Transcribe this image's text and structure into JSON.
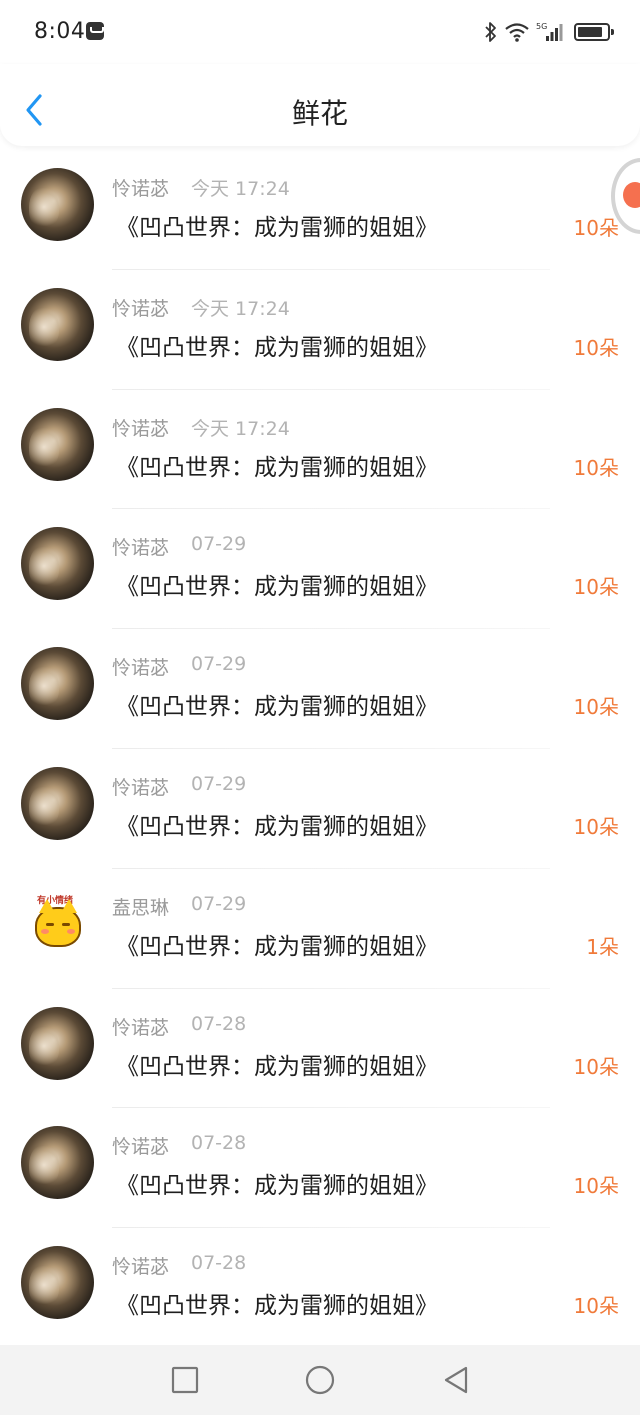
{
  "status_bar": {
    "time": "8:04",
    "icons": [
      "message-icon",
      "bluetooth-icon",
      "wifi-icon",
      "signal-5g-icon",
      "battery-icon"
    ]
  },
  "header": {
    "title": "鲜花",
    "back_icon": "chevron-left-icon",
    "accent_color": "#2196f3"
  },
  "items": [
    {
      "user": "怜诺苾",
      "time": "今天 17:24",
      "title": "《凹凸世界：成为雷狮的姐姐》",
      "count": "10朵",
      "avatar": "photo"
    },
    {
      "user": "怜诺苾",
      "time": "今天 17:24",
      "title": "《凹凸世界：成为雷狮的姐姐》",
      "count": "10朵",
      "avatar": "photo"
    },
    {
      "user": "怜诺苾",
      "time": "今天 17:24",
      "title": "《凹凸世界：成为雷狮的姐姐》",
      "count": "10朵",
      "avatar": "photo"
    },
    {
      "user": "怜诺苾",
      "time": "07-29",
      "title": "《凹凸世界：成为雷狮的姐姐》",
      "count": "10朵",
      "avatar": "photo"
    },
    {
      "user": "怜诺苾",
      "time": "07-29",
      "title": "《凹凸世界：成为雷狮的姐姐》",
      "count": "10朵",
      "avatar": "photo"
    },
    {
      "user": "怜诺苾",
      "time": "07-29",
      "title": "《凹凸世界：成为雷狮的姐姐》",
      "count": "10朵",
      "avatar": "photo"
    },
    {
      "user": "盍思琳",
      "time": "07-29",
      "title": "《凹凸世界：成为雷狮的姐姐》",
      "count": "1朵",
      "avatar": "cat",
      "avatar_text": "有小情绪"
    },
    {
      "user": "怜诺苾",
      "time": "07-28",
      "title": "《凹凸世界：成为雷狮的姐姐》",
      "count": "10朵",
      "avatar": "photo"
    },
    {
      "user": "怜诺苾",
      "time": "07-28",
      "title": "《凹凸世界：成为雷狮的姐姐》",
      "count": "10朵",
      "avatar": "photo"
    },
    {
      "user": "怜诺苾",
      "time": "07-28",
      "title": "《凹凸世界：成为雷狮的姐姐》",
      "count": "10朵",
      "avatar": "photo"
    }
  ],
  "colors": {
    "count": "#f07a3a",
    "username": "#9a9a9a",
    "timestamp": "#b3b3b3"
  },
  "nav_bar": {
    "buttons": [
      "recent-apps-icon",
      "home-icon",
      "back-triangle-icon"
    ]
  }
}
